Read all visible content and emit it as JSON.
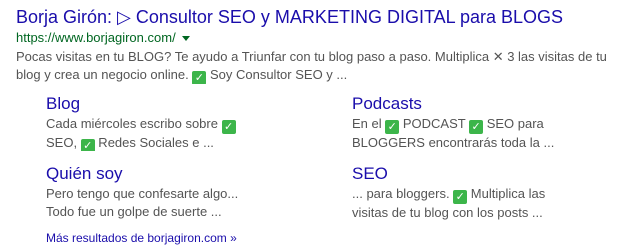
{
  "result": {
    "title": "Borja Girón: ▷ Consultor SEO y MARKETING DIGITAL para BLOGS",
    "url": "https://www.borjagiron.com/",
    "snippet_line1": "Pocas visitas en tu BLOG? Te ayudo a Triunfar con tu blog paso a paso. Multiplica ✕ 3 las visitas de tu",
    "snippet_line2_a": "blog y crea un negocio online. ",
    "snippet_line2_b": " Soy Consultor SEO y ..."
  },
  "icons": {
    "check": "✓",
    "check_color": "#3cb54a"
  },
  "colors": {
    "link": "#1a0dab",
    "url_green": "#006621",
    "snippet_gray": "#545454"
  },
  "sitelinks": [
    {
      "title": "Blog",
      "line1_a": "Cada miércoles escribo sobre ",
      "line1_b": "",
      "line2_a": "SEO, ",
      "line2_b": " Redes Sociales e ..."
    },
    {
      "title": "Podcasts",
      "line1_a": "En el ",
      "line1_b": " PODCAST ",
      "line1_c": " SEO para",
      "line2": "BLOGGERS encontrarás toda la ..."
    },
    {
      "title": "Quién soy",
      "line1": "Pero tengo que confesarte algo...",
      "line2": "Todo fue un golpe de suerte ..."
    },
    {
      "title": "SEO",
      "line1_a": "... para bloggers. ",
      "line1_b": " Multiplica las",
      "line2": "visitas de tu blog con los posts ..."
    }
  ],
  "more_results": "Más resultados de borjagiron.com »"
}
